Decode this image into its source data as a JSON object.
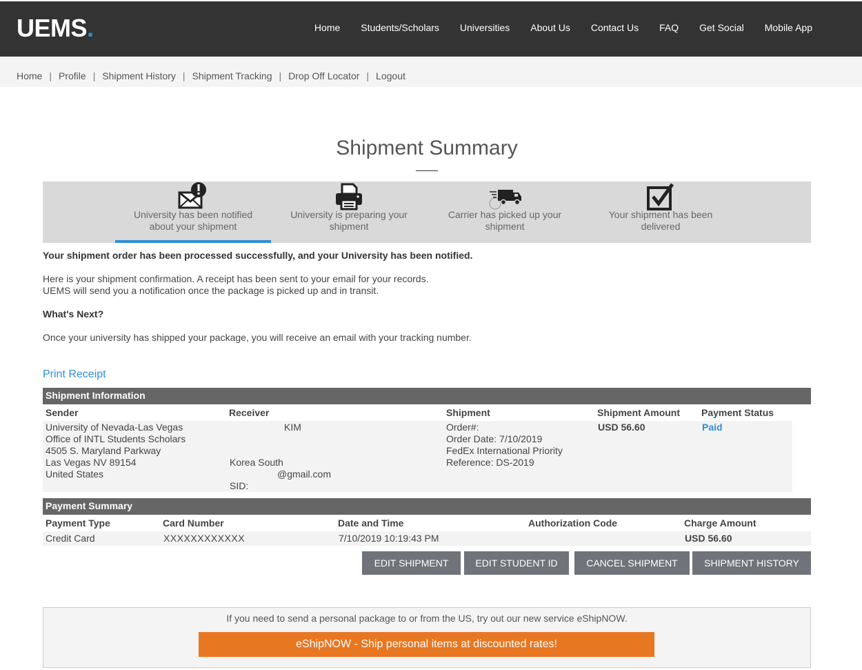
{
  "brand": {
    "name": "UEMS",
    "dot": "."
  },
  "main_nav": [
    "Home",
    "Students/Scholars",
    "Universities",
    "About Us",
    "Contact Us",
    "FAQ",
    "Get Social",
    "Mobile App"
  ],
  "sub_nav": [
    "Home",
    "Profile",
    "Shipment History",
    "Shipment Tracking",
    "Drop Off Locator",
    "Logout"
  ],
  "sub_nav_sep": "|",
  "page_title": "Shipment Summary",
  "steps": [
    {
      "icon": "envelope-alert-icon",
      "line1": "University has been notified",
      "line2": "about your shipment",
      "active": true
    },
    {
      "icon": "printer-icon",
      "line1": "University is preparing your",
      "line2": "shipment",
      "active": false
    },
    {
      "icon": "truck-icon",
      "line1": "Carrier has picked up your",
      "line2": "shipment",
      "active": false
    },
    {
      "icon": "checkbox-icon",
      "line1": "Your shipment has been",
      "line2": "delivered",
      "active": false
    }
  ],
  "messages": {
    "success": "Your shipment order has been processed successfully, and your University has been notified.",
    "confirm1": "Here is your shipment confirmation. A receipt has been sent to your email for your records.",
    "confirm2": "UEMS will send you a notification once the package is picked up and in transit.",
    "whats_next": "What's Next?",
    "next_text": "Once your university has shipped your package, you will receive an email with your tracking number."
  },
  "print_receipt": "Print Receipt",
  "shipment_info": {
    "heading": "Shipment Information",
    "columns": [
      "Sender",
      "Receiver",
      "Shipment",
      "Shipment Amount",
      "Payment Status"
    ],
    "sender": [
      "University of Nevada-Las Vegas",
      "Office of INTL Students Scholars",
      "4505 S. Maryland Parkway",
      "Las Vegas NV 89154",
      "United States"
    ],
    "receiver": {
      "name": "KIM",
      "country": "Korea South",
      "email": "@gmail.com",
      "sid": "SID:"
    },
    "shipment": [
      "Order#:",
      "Order Date: 7/10/2019",
      "FedEx International Priority",
      "Reference: DS-2019"
    ],
    "amount": "USD 56.60",
    "status": "Paid"
  },
  "payment_summary": {
    "heading": "Payment Summary",
    "columns": [
      "Payment Type",
      "Card Number",
      "Date and Time",
      "Authorization Code",
      "Charge Amount"
    ],
    "row": {
      "type": "Credit Card",
      "card": "XXXXXXXXXXXX",
      "datetime": "7/10/2019 10:19:43 PM",
      "auth": "",
      "amount": "USD 56.60"
    }
  },
  "buttons": [
    "EDIT SHIPMENT",
    "EDIT STUDENT ID",
    "CANCEL SHIPMENT",
    "SHIPMENT HISTORY"
  ],
  "promo": {
    "text": "If you need to send a personal package to or from the US, try out our new service eShipNOW.",
    "button": "eShipNOW - Ship personal items at discounted rates!"
  },
  "colors": {
    "header": "#333333",
    "accent": "#2b8fd6",
    "button": "#6e7479",
    "promo": "#e87722",
    "section": "#666666"
  }
}
